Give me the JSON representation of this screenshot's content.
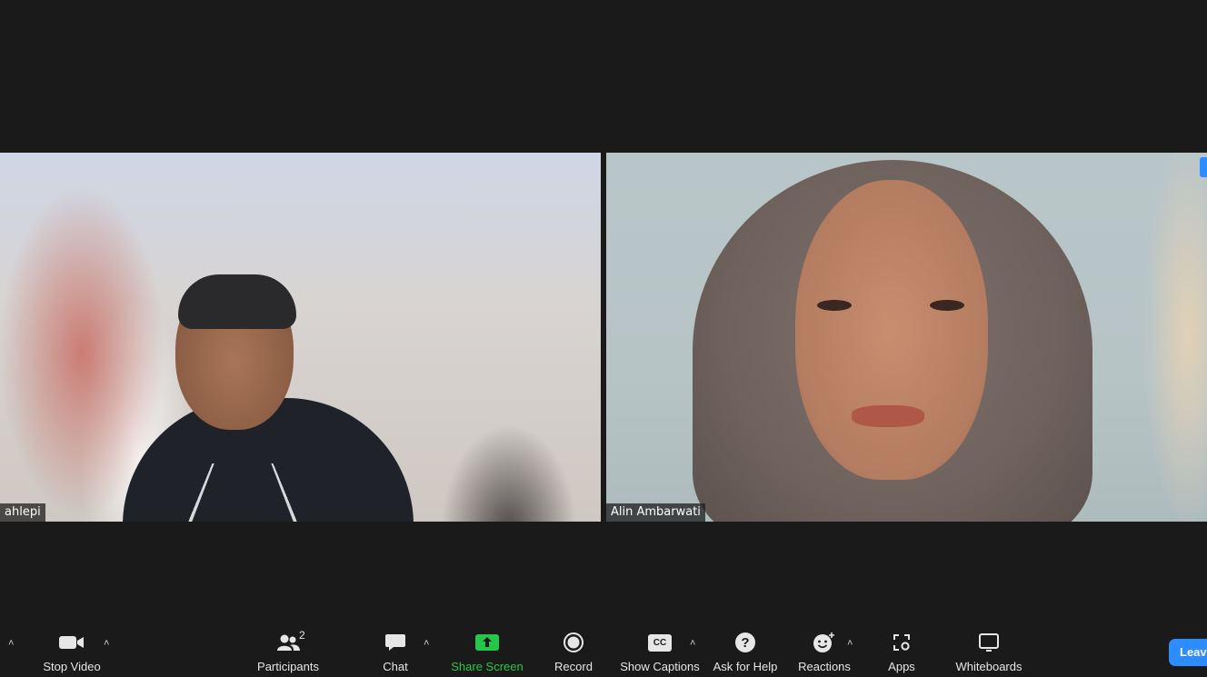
{
  "participants_tiles": [
    {
      "name": "ahlepi"
    },
    {
      "name": "Alin Ambarwati"
    }
  ],
  "toolbar": {
    "stop_video": "Stop Video",
    "participants": "Participants",
    "participants_count": "2",
    "chat": "Chat",
    "share_screen": "Share Screen",
    "record": "Record",
    "cc_text": "CC",
    "show_captions": "Show Captions",
    "ask_for_help": "Ask for Help",
    "reactions": "Reactions",
    "apps": "Apps",
    "whiteboards": "Whiteboards",
    "leave": "Leave"
  },
  "colors": {
    "background": "#1a1a1a",
    "share_green": "#24c749",
    "leave_blue": "#2d8cff"
  },
  "icons": [
    "video-camera-icon",
    "participants-icon",
    "chat-icon",
    "share-screen-icon",
    "record-icon",
    "captions-icon",
    "help-icon",
    "reactions-icon",
    "apps-icon",
    "whiteboard-icon"
  ]
}
